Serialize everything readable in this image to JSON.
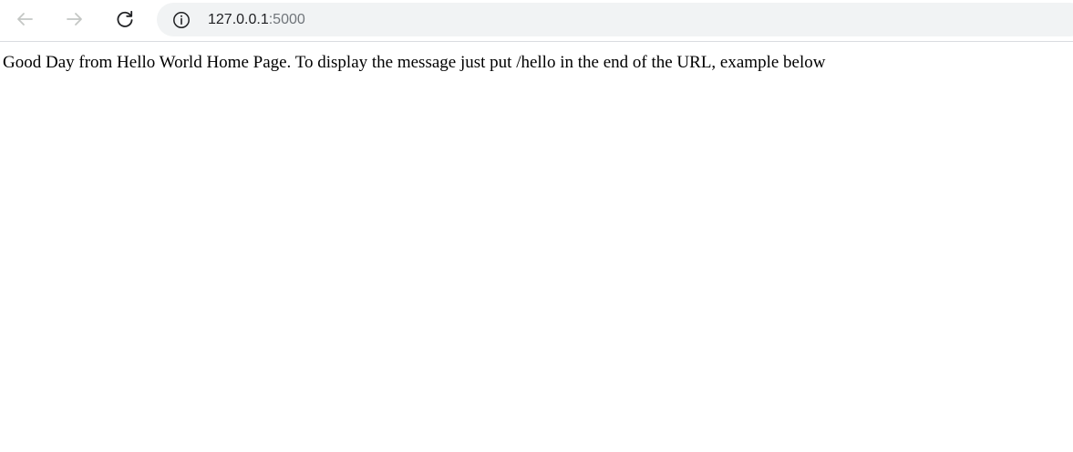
{
  "browser": {
    "icons": {
      "back": "arrow-left-icon",
      "forward": "arrow-right-icon",
      "reload": "reload-icon",
      "site_info": "info-circle-icon"
    },
    "address_bar": {
      "host": "127.0.0.1",
      "port": ":5000"
    },
    "colors": {
      "toolbar_bg": "#ffffff",
      "omnibox_bg": "#f1f3f4",
      "icon_active": "#5f6368",
      "icon_disabled": "#c4c7c5",
      "url_host": "#202124",
      "url_port": "#70757a"
    }
  },
  "page": {
    "message": "Good Day from Hello World Home Page. To display the message just put /hello in the end of the URL, example below"
  }
}
